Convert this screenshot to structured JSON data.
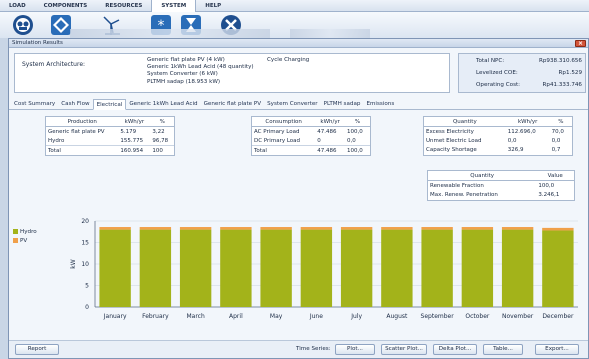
{
  "ribbon": {
    "tabs": [
      "LOAD",
      "COMPONENTS",
      "RESOURCES",
      "SYSTEM",
      "HELP"
    ],
    "active_tab": "SYSTEM",
    "icons": [
      "system-icon",
      "diamond-icon",
      "wind-turbine-icon",
      "snowflake-icon",
      "hourglass-icon",
      "close-circle-icon"
    ]
  },
  "window": {
    "title": "Simulation Results",
    "close_glyph": "×"
  },
  "architecture": {
    "label": "System Architecture:",
    "components": [
      "Generic flat plate PV (4 kW)",
      "Generic 1kWh Lead Acid (48 quantity)",
      "System Converter (6 kW)",
      "PLTMH sadap (18.953 kW)"
    ],
    "strategy": "Cycle Charging"
  },
  "costs": [
    {
      "label": "Total NPC:",
      "value": "Rp938.310.656"
    },
    {
      "label": "Levelized COE:",
      "value": "Rp1.529"
    },
    {
      "label": "Operating Cost:",
      "value": "Rp41.333.746"
    }
  ],
  "tabs": [
    "Cost Summary",
    "Cash Flow",
    "Electrical",
    "Generic 1kWh Lead Acid",
    "Generic flat plate PV",
    "System Converter",
    "PLTMH sadap",
    "Emissions"
  ],
  "active_tab": "Electrical",
  "production": {
    "headers": [
      "Production",
      "kWh/yr",
      "%"
    ],
    "rows": [
      [
        "Generic flat plate PV",
        "5.179",
        "3,22"
      ],
      [
        "Hydro",
        "155.775",
        "96,78"
      ],
      [
        "Total",
        "160.954",
        "100"
      ]
    ]
  },
  "consumption": {
    "headers": [
      "Consumption",
      "kWh/yr",
      "%"
    ],
    "rows": [
      [
        "AC Primary Load",
        "47.486",
        "100,0"
      ],
      [
        "DC Primary Load",
        "0",
        "0,0"
      ],
      [
        "Total",
        "47.486",
        "100,0"
      ]
    ]
  },
  "quantity1": {
    "headers": [
      "Quantity",
      "kWh/yr",
      "%"
    ],
    "rows": [
      [
        "Excess Electricity",
        "112.696,0",
        "70,0"
      ],
      [
        "Unmet Electric Load",
        "0,0",
        "0,0"
      ],
      [
        "Capacity Shortage",
        "326,9",
        "0,7"
      ]
    ]
  },
  "quantity2": {
    "headers": [
      "Quantity",
      "Value"
    ],
    "rows": [
      [
        "Renewable Fraction",
        "100,0"
      ],
      [
        "Max. Renew. Penetration",
        "3.246,1"
      ]
    ]
  },
  "chart_data": {
    "type": "bar",
    "stacked": true,
    "categories": [
      "January",
      "February",
      "March",
      "April",
      "May",
      "June",
      "July",
      "August",
      "September",
      "October",
      "November",
      "December"
    ],
    "series": [
      {
        "name": "Hydro",
        "color": "#a3b31a",
        "values": [
          18.0,
          18.0,
          18.0,
          18.0,
          18.0,
          18.0,
          18.0,
          18.0,
          18.0,
          18.0,
          18.0,
          17.8
        ]
      },
      {
        "name": "PV",
        "color": "#f0a04a",
        "values": [
          0.6,
          0.6,
          0.6,
          0.6,
          0.6,
          0.6,
          0.6,
          0.6,
          0.6,
          0.6,
          0.6,
          0.6
        ]
      }
    ],
    "ylabel": "kW",
    "ylim": [
      0,
      20
    ],
    "yticks": [
      0,
      5,
      10,
      15,
      20
    ],
    "legend": "left"
  },
  "bottom": {
    "report_label": "Report",
    "time_series_label": "Time Series:",
    "buttons": [
      "Plot...",
      "Scatter Plot...",
      "Delta Plot...",
      "Table...",
      "Export..."
    ]
  }
}
